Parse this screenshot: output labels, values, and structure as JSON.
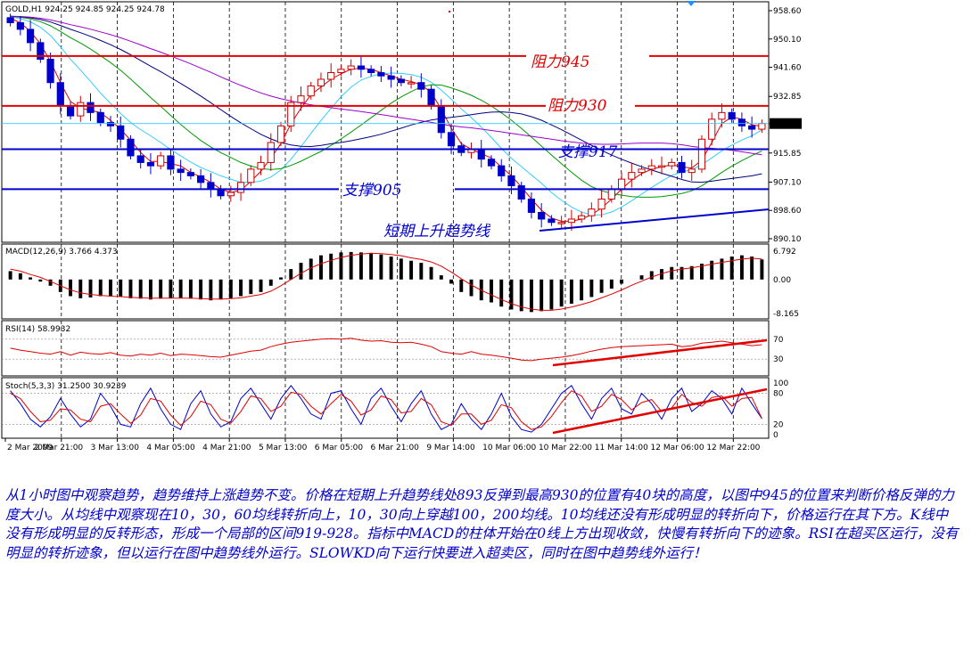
{
  "chart_data": {
    "type": "candlestick",
    "symbol_header": "GOLD,H1  924.25 924.85 924.25 924.78",
    "colors": {
      "bull": "#cc0000",
      "bear": "#0000cc",
      "ma10": "#e00000",
      "ma30": "#33ccff",
      "ma60": "#009900",
      "ma100": "#000080",
      "ma200": "#9900cc",
      "annotation_red": "#e00000",
      "annotation_blue": "#0000cc"
    },
    "price_axis": {
      "ticks": [
        "958.60",
        "950.10",
        "941.60",
        "932.85",
        "924.70",
        "915.85",
        "907.10",
        "898.60",
        "890.10"
      ],
      "min": 890.1,
      "max": 958.6,
      "current_price": "924.70"
    },
    "x_ticks": [
      "2 Mar 2009",
      "2 Mar 21:00",
      "3 Mar 13:00",
      "4 Mar 05:00",
      "4 Mar 21:00",
      "5 Mar 13:00",
      "6 Mar 05:00",
      "6 Mar 21:00",
      "9 Mar 14:00",
      "10 Mar 06:00",
      "10 Mar 22:00",
      "11 Mar 14:00",
      "12 Mar 06:00",
      "12 Mar 22:00"
    ],
    "close_path": [
      955,
      953,
      949,
      944,
      937,
      930,
      927,
      931,
      928,
      925,
      924,
      920,
      915,
      913,
      912,
      915,
      911,
      910,
      909,
      907,
      905,
      903,
      904,
      907,
      911,
      913,
      919,
      924,
      931,
      933,
      936,
      938,
      940,
      941,
      942,
      941,
      940,
      939,
      938,
      937,
      937,
      935,
      930,
      922,
      918,
      916,
      917,
      914,
      912,
      909,
      906,
      902,
      898,
      896,
      895,
      895,
      896,
      897,
      899,
      902,
      905,
      908,
      910,
      911,
      912,
      912,
      913,
      910,
      911,
      920,
      926,
      928,
      926,
      924,
      923,
      924.7
    ],
    "macd": {
      "title": "MACD(12,26,9) 3.766 4.373",
      "ticks": [
        "6.792",
        "0.00",
        "-8.165"
      ],
      "min": -8.165,
      "max": 6.792,
      "histogram": [
        2,
        1.5,
        0.5,
        -0.5,
        -1.5,
        -3,
        -4,
        -4.5,
        -4.3,
        -4,
        -4.1,
        -4.2,
        -4.5,
        -4.6,
        -4.8,
        -4.6,
        -4.5,
        -4.4,
        -4.6,
        -4.8,
        -5,
        -4.8,
        -4.5,
        -4,
        -3.5,
        -3,
        -1.5,
        0.5,
        2.5,
        4,
        5,
        5.8,
        6.2,
        6.5,
        6.6,
        6.5,
        6.3,
        6,
        5.5,
        5,
        4.5,
        4,
        3,
        1,
        -1,
        -3,
        -4,
        -5,
        -5.5,
        -6.5,
        -7.2,
        -7.6,
        -7.8,
        -7.6,
        -7.2,
        -6.5,
        -5.8,
        -5,
        -4.2,
        -3.2,
        -2.2,
        -1,
        0,
        1,
        2,
        2.5,
        3,
        3,
        3.2,
        3.8,
        4.5,
        5,
        5.5,
        5.8,
        5.5,
        4.8
      ],
      "signal": [
        2.5,
        2,
        1.2,
        0.5,
        -0.5,
        -1.5,
        -2.5,
        -3.2,
        -3.6,
        -3.8,
        -4,
        -4.1,
        -4.3,
        -4.4,
        -4.5,
        -4.5,
        -4.5,
        -4.5,
        -4.5,
        -4.6,
        -4.7,
        -4.7,
        -4.6,
        -4.4,
        -4,
        -3.6,
        -2.8,
        -1.5,
        0,
        1.5,
        2.8,
        3.8,
        4.6,
        5.3,
        5.8,
        6.1,
        6.3,
        6.2,
        6,
        5.7,
        5.2,
        4.8,
        4.2,
        3.2,
        1.8,
        0.2,
        -1.3,
        -2.6,
        -3.7,
        -4.8,
        -5.8,
        -6.6,
        -7.1,
        -7.4,
        -7.4,
        -7.1,
        -6.6,
        -6,
        -5.3,
        -4.4,
        -3.5,
        -2.5,
        -1.4,
        -0.4,
        0.6,
        1.4,
        2.1,
        2.5,
        2.8,
        3.2,
        3.7,
        4.1,
        4.5,
        4.9,
        5.1,
        4.9
      ]
    },
    "rsi": {
      "title": "RSI(14) 58.9932",
      "ticks": [
        "70",
        "30"
      ],
      "levels": [
        70,
        30
      ],
      "min": 0,
      "max": 100,
      "values": [
        52,
        48,
        45,
        42,
        40,
        45,
        38,
        44,
        41,
        40,
        43,
        38,
        36,
        40,
        38,
        42,
        37,
        40,
        39,
        37,
        35,
        34,
        38,
        42,
        46,
        48,
        55,
        60,
        64,
        66,
        68,
        70,
        71,
        70,
        72,
        68,
        66,
        67,
        64,
        63,
        64,
        60,
        55,
        45,
        42,
        40,
        45,
        40,
        38,
        35,
        32,
        28,
        27,
        30,
        32,
        34,
        37,
        41,
        46,
        50,
        53,
        55,
        56,
        57,
        58,
        59,
        60,
        55,
        57,
        62,
        64,
        66,
        63,
        60,
        57,
        59
      ]
    },
    "stoch": {
      "title": "Stoch(5,3,3) 31.2500 30.9239",
      "ticks": [
        "100",
        "80",
        "20",
        "0"
      ],
      "levels": [
        80,
        20
      ],
      "min": 0,
      "max": 100,
      "k": [
        85,
        60,
        30,
        15,
        35,
        70,
        40,
        15,
        30,
        80,
        55,
        20,
        15,
        60,
        90,
        50,
        20,
        10,
        60,
        85,
        40,
        15,
        25,
        70,
        90,
        60,
        30,
        70,
        95,
        70,
        40,
        30,
        80,
        85,
        50,
        20,
        70,
        90,
        55,
        25,
        60,
        85,
        40,
        10,
        20,
        60,
        30,
        10,
        40,
        80,
        35,
        10,
        5,
        20,
        50,
        80,
        95,
        60,
        30,
        70,
        90,
        50,
        40,
        80,
        60,
        30,
        70,
        90,
        45,
        60,
        85,
        70,
        40,
        90,
        60,
        31
      ],
      "d": [
        80,
        70,
        45,
        25,
        28,
        50,
        48,
        30,
        25,
        55,
        60,
        40,
        22,
        38,
        70,
        65,
        38,
        18,
        35,
        65,
        58,
        30,
        22,
        45,
        75,
        70,
        45,
        55,
        82,
        78,
        55,
        40,
        60,
        78,
        65,
        38,
        48,
        75,
        68,
        42,
        45,
        70,
        58,
        25,
        18,
        40,
        40,
        20,
        28,
        58,
        52,
        25,
        10,
        15,
        35,
        62,
        85,
        75,
        45,
        55,
        78,
        68,
        48,
        62,
        68,
        45,
        52,
        78,
        62,
        55,
        72,
        75,
        55,
        70,
        72,
        31
      ]
    },
    "annotations": [
      {
        "text": "阻力945",
        "price": 945,
        "color": "#e00000"
      },
      {
        "text": "阻力930",
        "price": 930,
        "color": "#e00000"
      },
      {
        "text": "支撑917",
        "price": 917,
        "color": "#0000cc"
      },
      {
        "text": "支撑905",
        "price": 905,
        "color": "#0000cc"
      },
      {
        "text": "短期上升趋势线",
        "color": "#0000cc"
      }
    ]
  },
  "analysis_text": "从1小时图中观察趋势，趋势维持上涨趋势不变。价格在短期上升趋势线处893反弹到最高930的位置有40块的高度，以图中945的位置来判断价格反弹的力度大小。从均线中观察现在10，30，60均线转折向上，10，30向上穿越100，200均线。10均线还没有形成明显的转折向下，价格运行在其下方。K线中没有形成明显的反转形态，形成一个局部的区间919-928。指标中MACD的柱体开始在0线上方出现收敛，快慢有转折向下的迹象。RSI在超买区运行，没有明显的转折迹象，但以运行在图中趋势线外运行。SLOWKD向下运行快要进入超卖区，同时在图中趋势线外运行！"
}
